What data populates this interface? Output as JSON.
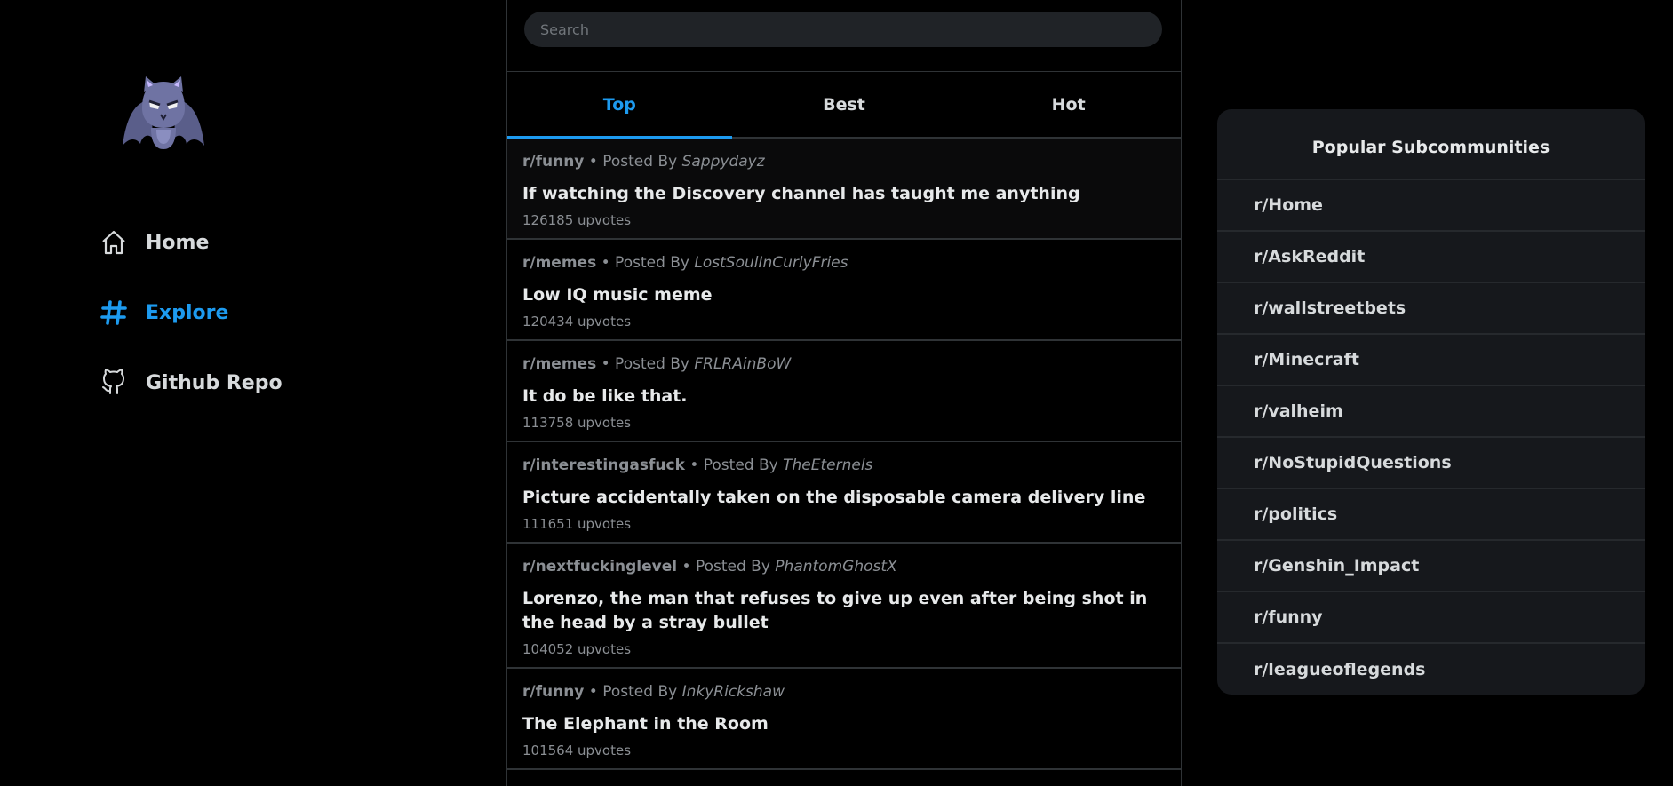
{
  "nav": {
    "items": [
      {
        "label": "Home",
        "icon": "home-icon"
      },
      {
        "label": "Explore",
        "icon": "hashtag-icon"
      },
      {
        "label": "Github Repo",
        "icon": "github-icon"
      }
    ],
    "active_color": "#1d9bf0"
  },
  "search": {
    "placeholder": "Search"
  },
  "tabs": [
    {
      "label": "Top"
    },
    {
      "label": "Best"
    },
    {
      "label": "Hot"
    }
  ],
  "posts": [
    {
      "subreddit": "r/funny",
      "posted_by": "Posted By",
      "author": "Sappydayz",
      "title": "If watching the Discovery channel has taught me anything",
      "votes": "126185 upvotes"
    },
    {
      "subreddit": "r/memes",
      "posted_by": "Posted By",
      "author": "LostSoulInCurlyFries",
      "title": "Low IQ music meme",
      "votes": "120434 upvotes"
    },
    {
      "subreddit": "r/memes",
      "posted_by": "Posted By",
      "author": "FRLRAinBoW",
      "title": "It do be like that.",
      "votes": "113758 upvotes"
    },
    {
      "subreddit": "r/interestingasfuck",
      "posted_by": "Posted By",
      "author": "TheEternels",
      "title": "Picture accidentally taken on the disposable camera delivery line",
      "votes": "111651 upvotes"
    },
    {
      "subreddit": "r/nextfuckinglevel",
      "posted_by": "Posted By",
      "author": "PhantomGhostX",
      "title": "Lorenzo, the man that refuses to give up even after being shot in the head by a stray bullet",
      "votes": "104052 upvotes"
    },
    {
      "subreddit": "r/funny",
      "posted_by": "Posted By",
      "author": "InkyRickshaw",
      "title": "The Elephant in the Room",
      "votes": "101564 upvotes"
    }
  ],
  "popular": {
    "title": "Popular Subcommunities",
    "items": [
      "r/Home",
      "r/AskReddit",
      "r/wallstreetbets",
      "r/Minecraft",
      "r/valheim",
      "r/NoStupidQuestions",
      "r/politics",
      "r/Genshin_Impact",
      "r/funny",
      "r/leagueoflegends"
    ]
  }
}
